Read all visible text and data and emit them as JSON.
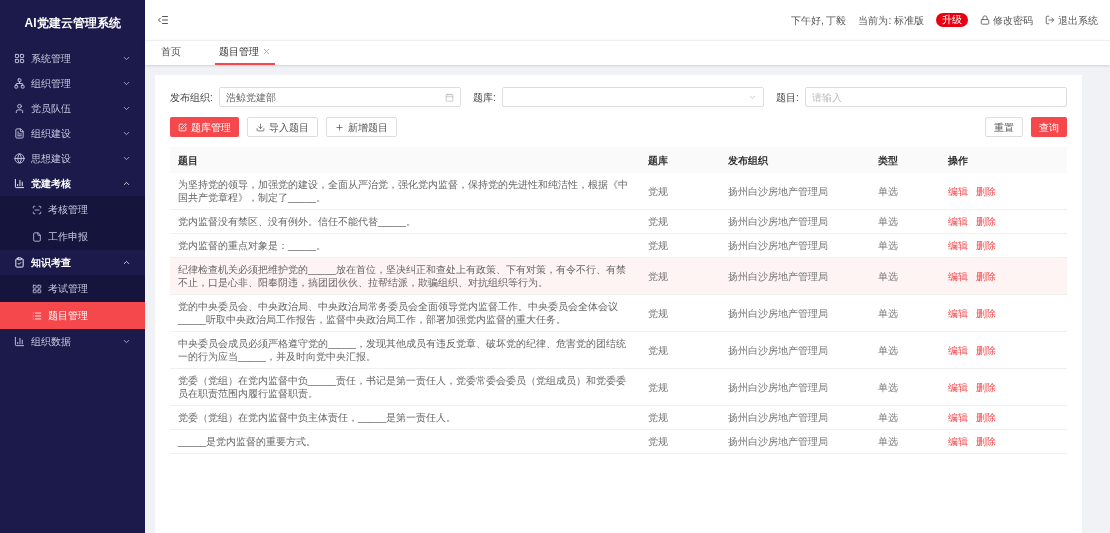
{
  "sidebar": {
    "title": "AI党建云管理系统",
    "items": [
      {
        "label": "系统管理",
        "expanded": false
      },
      {
        "label": "组织管理",
        "expanded": false
      },
      {
        "label": "党员队伍",
        "expanded": false
      },
      {
        "label": "组织建设",
        "expanded": false
      },
      {
        "label": "思想建设",
        "expanded": false
      },
      {
        "label": "党建考核",
        "expanded": true,
        "children": [
          {
            "label": "考核管理",
            "selected": false
          },
          {
            "label": "工作申报",
            "selected": false
          }
        ]
      },
      {
        "label": "知识考查",
        "expanded": true,
        "children": [
          {
            "label": "考试管理",
            "selected": false
          },
          {
            "label": "题目管理",
            "selected": true
          }
        ]
      },
      {
        "label": "组织数据",
        "expanded": false
      }
    ]
  },
  "header": {
    "greeting": "下午好, 丁毅",
    "edition": "当前为: 标准版",
    "upgrade": "升级",
    "change_password": "修改密码",
    "logout": "退出系统"
  },
  "tabs": [
    {
      "label": "首页",
      "selected": false,
      "closable": false
    },
    {
      "label": "题目管理",
      "selected": true,
      "closable": true
    }
  ],
  "filters": [
    {
      "kind": "picker",
      "label": "发布组织:",
      "value": "浩鲸党建部"
    },
    {
      "kind": "select",
      "label": "题库:"
    },
    {
      "kind": "input",
      "label": "题目:",
      "placeholder": "请输入"
    }
  ],
  "actions": [
    {
      "label": "题库管理",
      "kind": "primary"
    },
    {
      "label": "导入题目",
      "kind": "default"
    },
    {
      "label": "新增题目",
      "kind": "default"
    }
  ],
  "search_buttons": [
    {
      "label": "重置",
      "kind": "default"
    },
    {
      "label": "查询",
      "kind": "primary"
    }
  ],
  "table": {
    "columns": [
      "题目",
      "题库",
      "发布组织",
      "类型",
      "操作"
    ],
    "rows": [
      {
        "question": "为坚持党的领导，加强党的建设，全面从严治党，强化党内监督，保持党的先进性和纯洁性，根据《中国共产党章程》，制定了_____。",
        "bank": "党规",
        "org": "扬州白沙房地产管理局",
        "type": "单选",
        "edit": "编辑",
        "delete": "删除",
        "highlighted": false
      },
      {
        "question": "党内监督没有禁区、没有例外。信任不能代替_____。",
        "bank": "党规",
        "org": "扬州白沙房地产管理局",
        "type": "单选",
        "edit": "编辑",
        "delete": "删除",
        "highlighted": false
      },
      {
        "question": "党内监督的重点对象是：_____。",
        "bank": "党规",
        "org": "扬州白沙房地产管理局",
        "type": "单选",
        "edit": "编辑",
        "delete": "删除",
        "highlighted": false
      },
      {
        "question": "纪律检查机关必须把维护党的_____放在首位，坚决纠正和查处上有政策、下有对策，有令不行、有禁不止，口是心非、阳奉阴违，搞团团伙伙、拉帮结派，欺骗组织、对抗组织等行为。",
        "bank": "党规",
        "org": "扬州白沙房地产管理局",
        "type": "单选",
        "edit": "编辑",
        "delete": "删除",
        "highlighted": true
      },
      {
        "question": "党的中央委员会、中央政治局、中央政治局常务委员会全面领导党内监督工作。中央委员会全体会议_____听取中央政治局工作报告，监督中央政治局工作，部署加强党内监督的重大任务。",
        "bank": "党规",
        "org": "扬州白沙房地产管理局",
        "type": "单选",
        "edit": "编辑",
        "delete": "删除",
        "highlighted": false
      },
      {
        "question": "中央委员会成员必须严格遵守党的_____，发现其他成员有违反党章、破坏党的纪律、危害党的团结统一的行为应当_____，并及时向党中央汇报。",
        "bank": "党规",
        "org": "扬州白沙房地产管理局",
        "type": "单选",
        "edit": "编辑",
        "delete": "删除",
        "highlighted": false
      },
      {
        "question": "党委（党组）在党内监督中负_____责任，书记是第一责任人，党委常委会委员（党组成员）和党委委员在职责范围内履行监督职责。",
        "bank": "党规",
        "org": "扬州白沙房地产管理局",
        "type": "单选",
        "edit": "编辑",
        "delete": "删除",
        "highlighted": false
      },
      {
        "question": "党委（党组）在党内监督中负主体责任，_____是第一责任人。",
        "bank": "党规",
        "org": "扬州白沙房地产管理局",
        "type": "单选",
        "edit": "编辑",
        "delete": "删除",
        "highlighted": false
      },
      {
        "question": "_____是党内监督的重要方式。",
        "bank": "党规",
        "org": "扬州白沙房地产管理局",
        "type": "单选",
        "edit": "编辑",
        "delete": "删除",
        "highlighted": false
      }
    ]
  }
}
